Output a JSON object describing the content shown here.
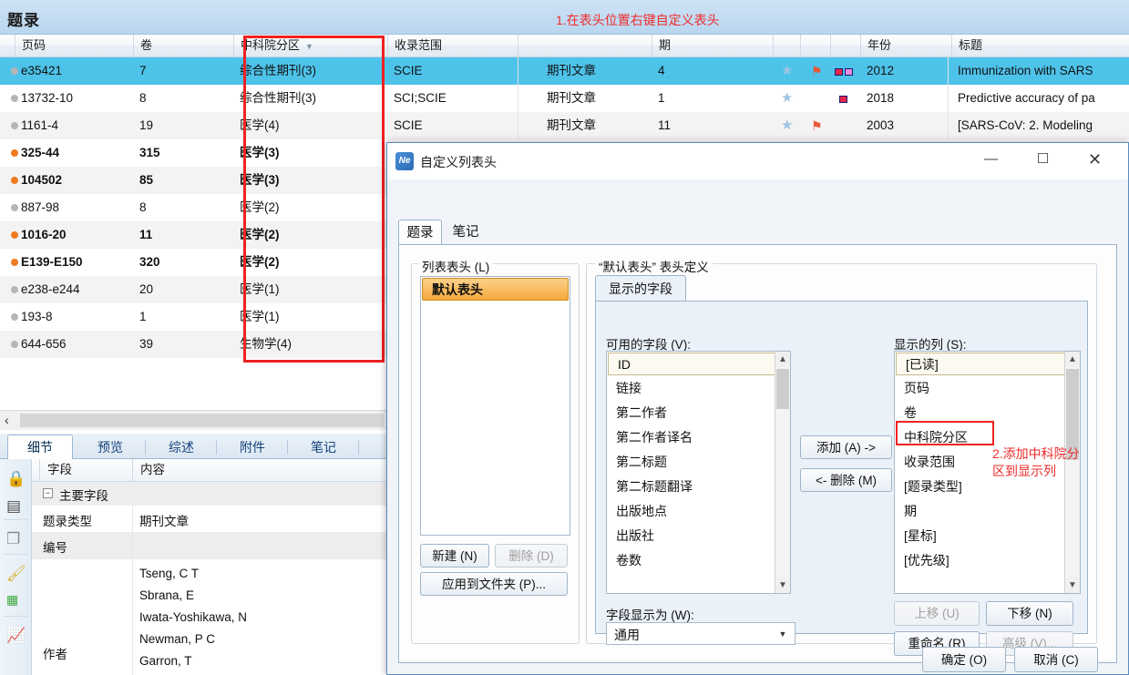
{
  "banner": {
    "title": "题录",
    "annotation": "1.在表头位置右键自定义表头"
  },
  "grid": {
    "columns": [
      {
        "key": "dot",
        "label": ""
      },
      {
        "key": "pages",
        "label": "页码"
      },
      {
        "key": "volume",
        "label": "卷"
      },
      {
        "key": "cas_zone",
        "label": "中科院分区",
        "sort_indicator": "▼"
      },
      {
        "key": "index_scope",
        "label": "收录范围"
      },
      {
        "key": "ref_type",
        "label": ""
      },
      {
        "key": "issue",
        "label": "期"
      },
      {
        "key": "star",
        "label": ""
      },
      {
        "key": "flag",
        "label": ""
      },
      {
        "key": "priority",
        "label": ""
      },
      {
        "key": "year",
        "label": "年份"
      },
      {
        "key": "title",
        "label": "标题"
      }
    ],
    "rows": [
      {
        "dot": "grey",
        "pages": "e35421",
        "volume": "7",
        "cas_zone": "综合性期刊(3)",
        "index_scope": "SCIE",
        "ref_type": "期刊文章",
        "issue": "4",
        "star": true,
        "flag": true,
        "squares": 2,
        "year": "2012",
        "title": "Immunization with SARS",
        "selected": true,
        "bold": false
      },
      {
        "dot": "grey",
        "pages": "13732-10",
        "volume": "8",
        "cas_zone": "综合性期刊(3)",
        "index_scope": "SCI;SCIE",
        "ref_type": "期刊文章",
        "issue": "1",
        "star": true,
        "flag": false,
        "squares": 1,
        "year": "2018",
        "title": "Predictive accuracy of pa",
        "selected": false,
        "bold": false
      },
      {
        "dot": "grey",
        "pages": "1161-4",
        "volume": "19",
        "cas_zone": "医学(4)",
        "index_scope": "SCIE",
        "ref_type": "期刊文章",
        "issue": "11",
        "star": true,
        "flag": true,
        "squares": 0,
        "year": "2003",
        "title": "[SARS-CoV: 2. Modeling",
        "selected": false,
        "bold": false
      },
      {
        "dot": "orange",
        "pages": "325-44",
        "volume": "315",
        "cas_zone": "医学(3)",
        "bold": true
      },
      {
        "dot": "orange",
        "pages": "104502",
        "volume": "85",
        "cas_zone": "医学(3)",
        "bold": true
      },
      {
        "dot": "grey",
        "pages": "887-98",
        "volume": "8",
        "cas_zone": "医学(2)",
        "bold": false
      },
      {
        "dot": "orange",
        "pages": "1016-20",
        "volume": "11",
        "cas_zone": "医学(2)",
        "bold": true
      },
      {
        "dot": "orange",
        "pages": "E139-E150",
        "volume": "320",
        "cas_zone": "医学(2)",
        "bold": true
      },
      {
        "dot": "grey",
        "pages": "e238-e244",
        "volume": "20",
        "cas_zone": "医学(1)",
        "bold": false
      },
      {
        "dot": "grey",
        "pages": "193-8",
        "volume": "1",
        "cas_zone": "医学(1)",
        "bold": false
      },
      {
        "dot": "grey",
        "pages": "644-656",
        "volume": "39",
        "cas_zone": "生物学(4)",
        "bold": false
      }
    ]
  },
  "detail": {
    "tabs": [
      {
        "label": "细节",
        "active": true
      },
      {
        "label": "预览",
        "active": false
      },
      {
        "label": "综述",
        "active": false
      },
      {
        "label": "附件",
        "active": false
      },
      {
        "label": "笔记",
        "active": false
      }
    ],
    "rail_icons": [
      "lock-icon",
      "door-icon",
      "copy-icon",
      "brush-icon",
      "grid-icon",
      "chart-icon"
    ],
    "headers": [
      "字段",
      "内容"
    ],
    "rows": [
      {
        "field": "主要字段",
        "value": "",
        "group": true
      },
      {
        "field": "题录类型",
        "value": "期刊文章"
      },
      {
        "field": "编号",
        "value": ""
      },
      {
        "field": "作者",
        "value": "Tseng, C T\nSbrana, E\nIwata-Yoshikawa, N\nNewman, P C\nGarron, T"
      }
    ]
  },
  "dialog": {
    "title": "自定义列表头",
    "icon": "noteexpress-icon",
    "window_buttons": [
      {
        "name": "minimize",
        "glyph": "—"
      },
      {
        "name": "maximize",
        "glyph": "☐"
      },
      {
        "name": "close",
        "glyph": "✕"
      }
    ],
    "tabs": [
      {
        "label": "题录",
        "active": true
      },
      {
        "label": "笔记",
        "active": false
      }
    ],
    "left_group_label": "列表表头 (L)",
    "header_list": [
      {
        "label": "默认表头",
        "selected": true
      }
    ],
    "left_buttons": [
      {
        "label": "新建 (N)",
        "accel": "N",
        "disabled": false
      },
      {
        "label": "删除 (D)",
        "accel": "D",
        "disabled": true
      },
      {
        "label": "应用到文件夹 (P)...",
        "accel": "P",
        "disabled": false
      }
    ],
    "right_group_label": "“默认表头” 表头定义",
    "inner_tab": "显示的字段",
    "available_label": "可用的字段 (V):",
    "available_fields": [
      {
        "label": "ID",
        "selected": true
      },
      {
        "label": "链接"
      },
      {
        "label": "第二作者"
      },
      {
        "label": "第二作者译名"
      },
      {
        "label": "第二标题"
      },
      {
        "label": "第二标题翻译"
      },
      {
        "label": "出版地点"
      },
      {
        "label": "出版社"
      },
      {
        "label": "卷数"
      }
    ],
    "displayed_label": "显示的列 (S):",
    "displayed_fields": [
      {
        "label": "[已读]",
        "selected": true
      },
      {
        "label": "页码"
      },
      {
        "label": "卷"
      },
      {
        "label": "中科院分区",
        "highlighted": true
      },
      {
        "label": "收录范围"
      },
      {
        "label": "[题录类型]"
      },
      {
        "label": "期"
      },
      {
        "label": "[星标]"
      },
      {
        "label": "[优先级]"
      }
    ],
    "transfer_buttons": [
      {
        "label": "添加 (A) ->",
        "name": "add-button"
      },
      {
        "label": "<- 删除 (M)",
        "name": "remove-button"
      }
    ],
    "move_buttons": [
      {
        "label": "上移 (U)",
        "disabled": true
      },
      {
        "label": "下移 (N)",
        "disabled": false
      },
      {
        "label": "重命名 (R)",
        "disabled": false
      },
      {
        "label": "高级 (V)...",
        "disabled": true
      }
    ],
    "field_display_label": "字段显示为 (W):",
    "field_display_value": "通用",
    "footer_buttons": [
      {
        "label": "确定 (O)"
      },
      {
        "label": "取消 (C)"
      }
    ],
    "annotation_line1": "2.添加中科院分",
    "annotation_line2": "区到显示列"
  },
  "colors": {
    "selection_blue": "#4ec3ea",
    "annotation_red": "#ef2b2b",
    "highlight_orange": "#f5a93c",
    "banner_blue": "#c3dcf2"
  }
}
